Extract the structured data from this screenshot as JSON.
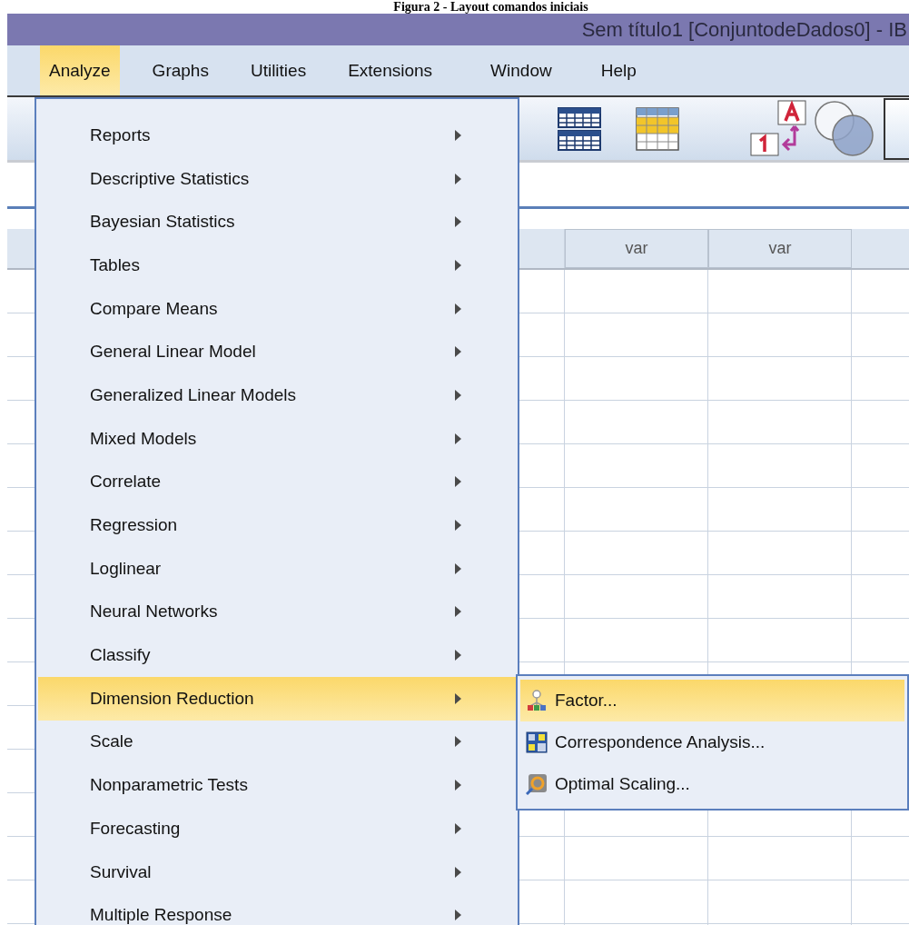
{
  "caption": "Figura 2 - Layout comandos iniciais",
  "window": {
    "title": "Sem título1 [ConjuntodeDados0] - IB"
  },
  "menubar": [
    {
      "label": "Analyze",
      "selected": true
    },
    {
      "label": "Graphs",
      "selected": false
    },
    {
      "label": "Utilities",
      "selected": false
    },
    {
      "label": "Extensions",
      "selected": false
    },
    {
      "label": "Window",
      "selected": false
    },
    {
      "label": "Help",
      "selected": false
    }
  ],
  "grid": {
    "columns": [
      "var",
      "var"
    ]
  },
  "analyze_menu": {
    "items": [
      {
        "label": "Reports",
        "selected": false
      },
      {
        "label": "Descriptive Statistics",
        "selected": false
      },
      {
        "label": "Bayesian Statistics",
        "selected": false
      },
      {
        "label": "Tables",
        "selected": false
      },
      {
        "label": "Compare Means",
        "selected": false
      },
      {
        "label": "General Linear Model",
        "selected": false
      },
      {
        "label": "Generalized Linear Models",
        "selected": false
      },
      {
        "label": "Mixed Models",
        "selected": false
      },
      {
        "label": "Correlate",
        "selected": false
      },
      {
        "label": "Regression",
        "selected": false
      },
      {
        "label": "Loglinear",
        "selected": false
      },
      {
        "label": "Neural Networks",
        "selected": false
      },
      {
        "label": "Classify",
        "selected": false
      },
      {
        "label": "Dimension Reduction",
        "selected": true
      },
      {
        "label": "Scale",
        "selected": false
      },
      {
        "label": "Nonparametric Tests",
        "selected": false
      },
      {
        "label": "Forecasting",
        "selected": false
      },
      {
        "label": "Survival",
        "selected": false
      },
      {
        "label": "Multiple Response",
        "selected": false
      }
    ]
  },
  "submenu": {
    "items": [
      {
        "label": "Factor...",
        "selected": true,
        "kind": "factor"
      },
      {
        "label": "Correspondence Analysis...",
        "selected": false,
        "kind": "correspondence"
      },
      {
        "label": "Optimal Scaling...",
        "selected": false,
        "kind": "optimal"
      }
    ]
  }
}
